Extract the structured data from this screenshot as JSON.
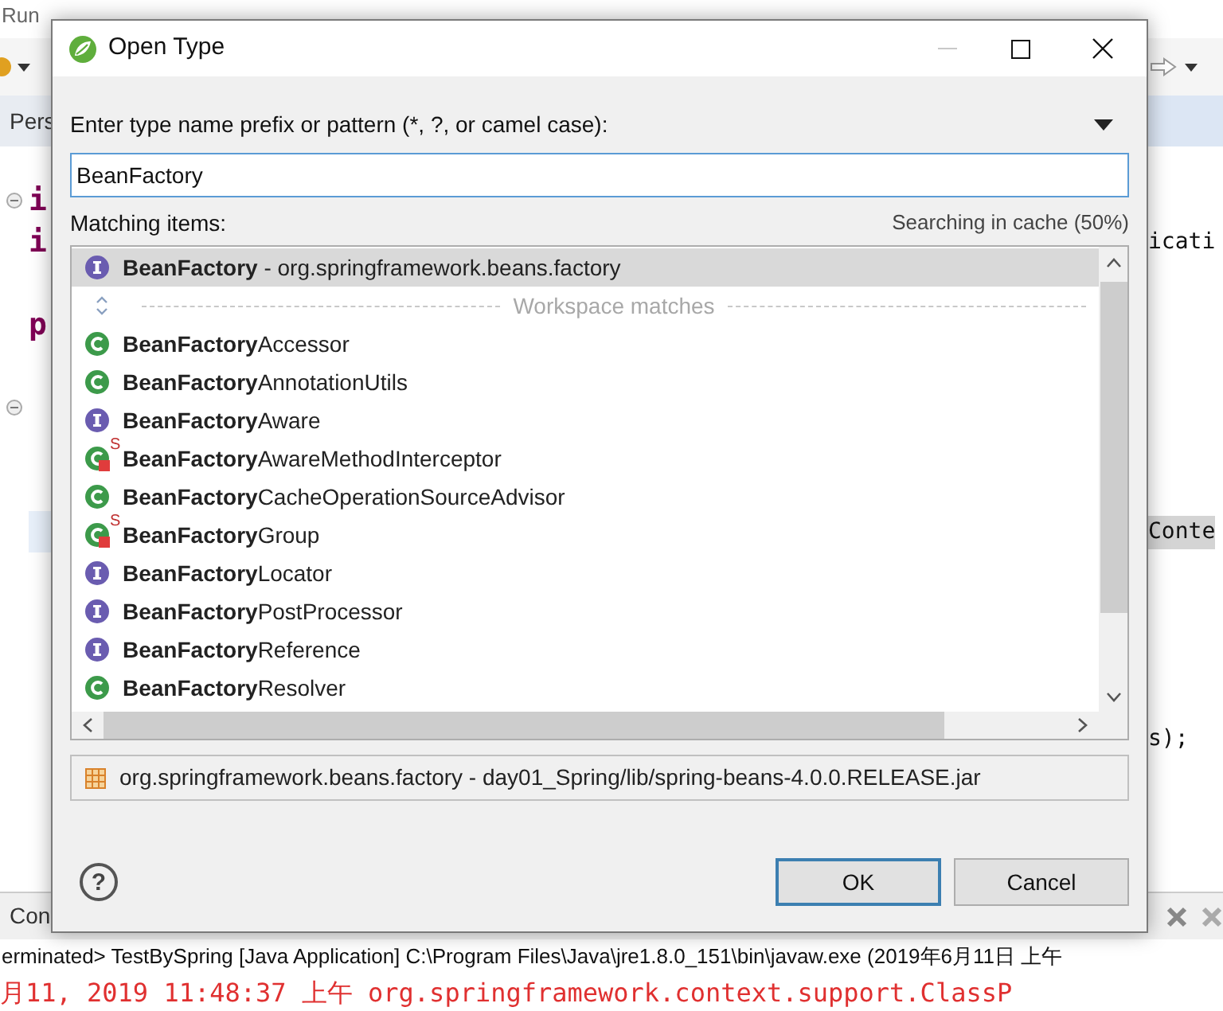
{
  "menu": [
    "Run"
  ],
  "perspective_tab": "Pers",
  "editor": {
    "lines": [
      {
        "left": "i",
        "fold": true,
        "current": false
      },
      {
        "left": "i",
        "right": "icati",
        "fold": false,
        "current": false
      },
      {
        "left": "p",
        "fold": false,
        "current": false
      },
      {
        "fold": true,
        "current": false
      },
      {
        "right": "Conte",
        "fold": false,
        "current": true
      },
      {
        "right": "s);",
        "fold": false,
        "current": false
      }
    ]
  },
  "console": {
    "tab": "Con",
    "lines": [
      {
        "kind": "header",
        "text": "erminated> TestBySpring [Java Application] C:\\Program Files\\Java\\jre1.8.0_151\\bin\\javaw.exe (2019年6月11日 上午"
      },
      {
        "kind": "error",
        "text": "月11, 2019 11:48:37 上午 org.springframework.context.support.ClassP"
      }
    ]
  },
  "dialog": {
    "title": "Open Type",
    "pattern_label": "Enter type name prefix or pattern (*, ?, or camel case):",
    "pattern_value": "BeanFactory",
    "matching_label": "Matching items:",
    "status": "Searching in cache (50%)",
    "items": [
      {
        "kind": "interface",
        "label": "**BeanFactory** - org.springframework.beans.factory",
        "selected": true
      },
      {
        "kind": "separator",
        "label": "Workspace matches"
      },
      {
        "kind": "class",
        "label": "**BeanFactory**Accessor",
        "selected": false
      },
      {
        "kind": "class",
        "label": "**BeanFactory**AnnotationUtils",
        "selected": false
      },
      {
        "kind": "interface",
        "label": "**BeanFactory**Aware",
        "selected": false
      },
      {
        "kind": "private-class",
        "badge": "S",
        "label": "**BeanFactory**AwareMethodInterceptor",
        "selected": false
      },
      {
        "kind": "class",
        "label": "**BeanFactory**CacheOperationSourceAdvisor",
        "selected": false
      },
      {
        "kind": "private-class",
        "badge": "S",
        "label": "**BeanFactory**Group",
        "selected": false
      },
      {
        "kind": "interface",
        "label": "**BeanFactory**Locator",
        "selected": false
      },
      {
        "kind": "interface",
        "label": "**BeanFactory**PostProcessor",
        "selected": false
      },
      {
        "kind": "interface",
        "label": "**BeanFactory**Reference",
        "selected": false
      },
      {
        "kind": "class",
        "label": "**BeanFactory**Resolver",
        "selected": false
      }
    ],
    "details": "org.springframework.beans.factory - day01_Spring/lib/spring-beans-4.0.0.RELEASE.jar",
    "help": "?",
    "buttons": [
      {
        "label": "OK",
        "default": true
      },
      {
        "label": "Cancel",
        "default": false
      }
    ]
  }
}
